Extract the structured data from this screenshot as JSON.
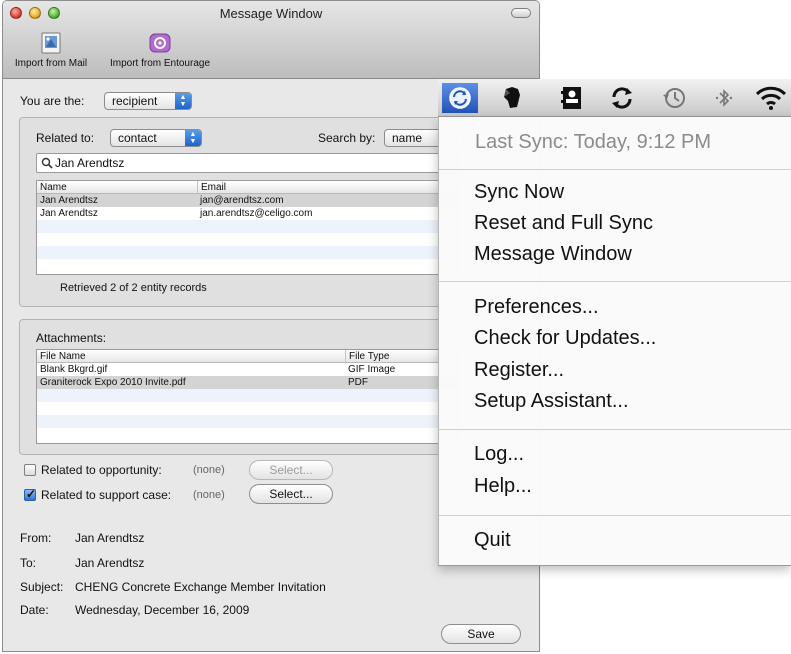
{
  "window": {
    "title": "Message Window",
    "toolbar": {
      "import_mail": "Import from Mail",
      "import_entourage": "Import from Entourage"
    }
  },
  "role": {
    "label": "You are the:",
    "value": "recipient"
  },
  "related": {
    "label": "Related to:",
    "value": "contact",
    "search_by_label": "Search by:",
    "search_by_value": "name",
    "search_text": "Jan Arendtsz",
    "columns": [
      "Name",
      "Email"
    ],
    "rows": [
      {
        "name": "Jan Arendtsz",
        "email": "jan@arendtsz.com"
      },
      {
        "name": "Jan Arendtsz",
        "email": "jan.arendtsz@celigo.com"
      }
    ],
    "status": "Retrieved 2 of 2 entity records"
  },
  "attachments": {
    "label": "Attachments:",
    "columns": [
      "File Name",
      "File Type"
    ],
    "rows": [
      {
        "name": "Blank Bkgrd.gif",
        "type": "GIF Image"
      },
      {
        "name": "Graniterock Expo 2010 Invite.pdf",
        "type": "PDF"
      }
    ]
  },
  "options": {
    "opportunity": {
      "label": "Related to opportunity:",
      "value": "(none)",
      "button": "Select...",
      "checked": false
    },
    "support_case": {
      "label": "Related to support case:",
      "value": "(none)",
      "button": "Select...",
      "checked": true
    }
  },
  "message": {
    "from_label": "From:",
    "from": "Jan Arendtsz",
    "to_label": "To:",
    "to": "Jan Arendtsz",
    "subject_label": "Subject:",
    "subject": "CHENG Concrete Exchange Member Invitation",
    "date_label": "Date:",
    "date": "Wednesday, December 16, 2009"
  },
  "save_button": "Save",
  "menubar_icons": [
    "sync-icon",
    "evernote-icon",
    "contact-icon",
    "refresh-icon",
    "time-machine-icon",
    "bluetooth-icon",
    "wifi-icon"
  ],
  "menu": {
    "last_sync": "Last Sync: Today, 9:12 PM",
    "items": {
      "sync_now": "Sync Now",
      "reset_full": "Reset and Full Sync",
      "message_window": "Message Window",
      "preferences": "Preferences...",
      "check_updates": "Check for Updates...",
      "register": "Register...",
      "setup_assistant": "Setup Assistant...",
      "log": "Log...",
      "help": "Help...",
      "quit": "Quit"
    }
  },
  "colors": {
    "accent": "#2f72d6",
    "menu_highlight": "#2353b8",
    "selection": "#d4d4d4"
  }
}
